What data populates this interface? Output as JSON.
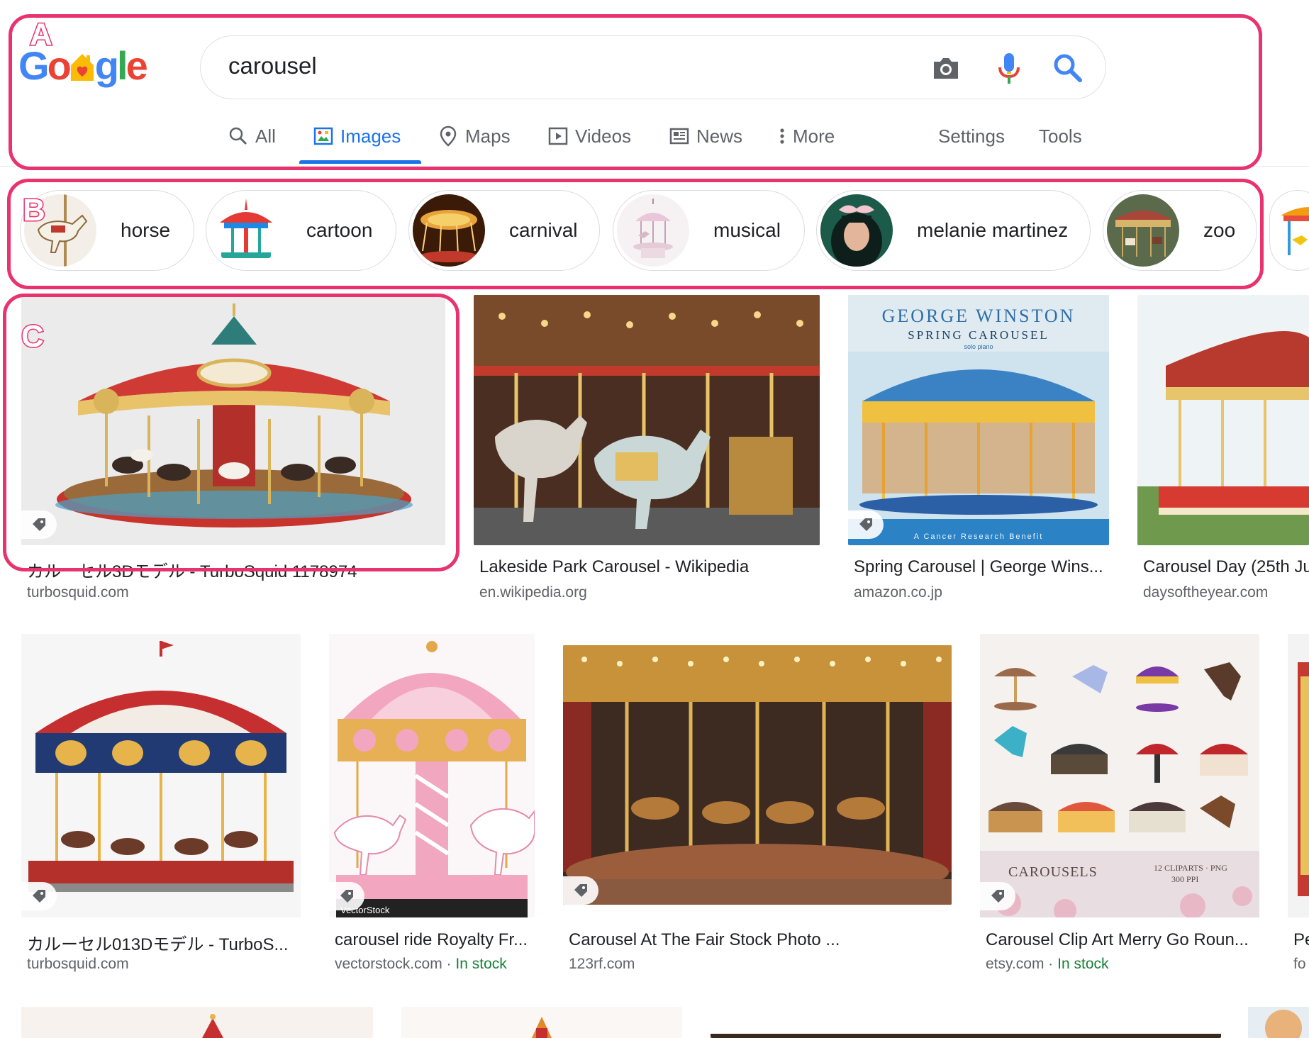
{
  "header": {
    "logo_letters": [
      "G",
      "o",
      "o",
      "g",
      "l",
      "e"
    ],
    "search_query": "carousel",
    "tabs": [
      {
        "label": "All",
        "icon": "search-icon"
      },
      {
        "label": "Images",
        "icon": "image-icon",
        "active": true
      },
      {
        "label": "Maps",
        "icon": "map-pin-icon"
      },
      {
        "label": "Videos",
        "icon": "play-icon"
      },
      {
        "label": "News",
        "icon": "news-icon"
      },
      {
        "label": "More",
        "icon": "more-vert-icon"
      }
    ],
    "settings_label": "Settings",
    "tools_label": "Tools"
  },
  "chips": [
    {
      "label": "horse"
    },
    {
      "label": "cartoon"
    },
    {
      "label": "carnival"
    },
    {
      "label": "musical"
    },
    {
      "label": "melanie martinez"
    },
    {
      "label": "zoo"
    }
  ],
  "results": [
    {
      "caption": "カルーセル3Dモデル - TurboSquid 1178974",
      "source": "turbosquid.com"
    },
    {
      "caption": "Lakeside Park Carousel - Wikipedia",
      "source": "en.wikipedia.org"
    },
    {
      "caption": "Spring Carousel | George Wins...",
      "source": "amazon.co.jp",
      "image_text_1": "GEORGE WINSTON",
      "image_text_2": "SPRING CAROUSEL",
      "image_text_3": "solo piano",
      "image_text_4": "A Cancer Research Benefit"
    },
    {
      "caption": "Carousel Day (25th Ju",
      "source": "daysoftheyear.com"
    },
    {
      "caption": "カルーセル013Dモデル - TurboS...",
      "source": "turbosquid.com"
    },
    {
      "caption": "carousel ride Royalty Fr...",
      "source": "vectorstock.com",
      "stock": "In stock",
      "image_text": "VectorStock"
    },
    {
      "caption": "Carousel At The Fair Stock Photo ...",
      "source": "123rf.com"
    },
    {
      "caption": "Carousel Clip Art Merry Go Roun...",
      "source": "etsy.com",
      "stock": "In stock",
      "image_text_1": "CAROUSELS",
      "image_text_2": "12 CLIPARTS · PNG",
      "image_text_3": "300 PPI"
    },
    {
      "caption": "Pe",
      "source": "fo"
    }
  ],
  "separator": " · ",
  "annotations": [
    "A",
    "B",
    "C"
  ],
  "colors": {
    "google_blue": "#4285f4",
    "google_red": "#ea4335",
    "google_yellow": "#fbbc05",
    "google_green": "#34a853",
    "accent": "#1a73e8",
    "annotation": "#e8336e",
    "in_stock": "#188038"
  }
}
